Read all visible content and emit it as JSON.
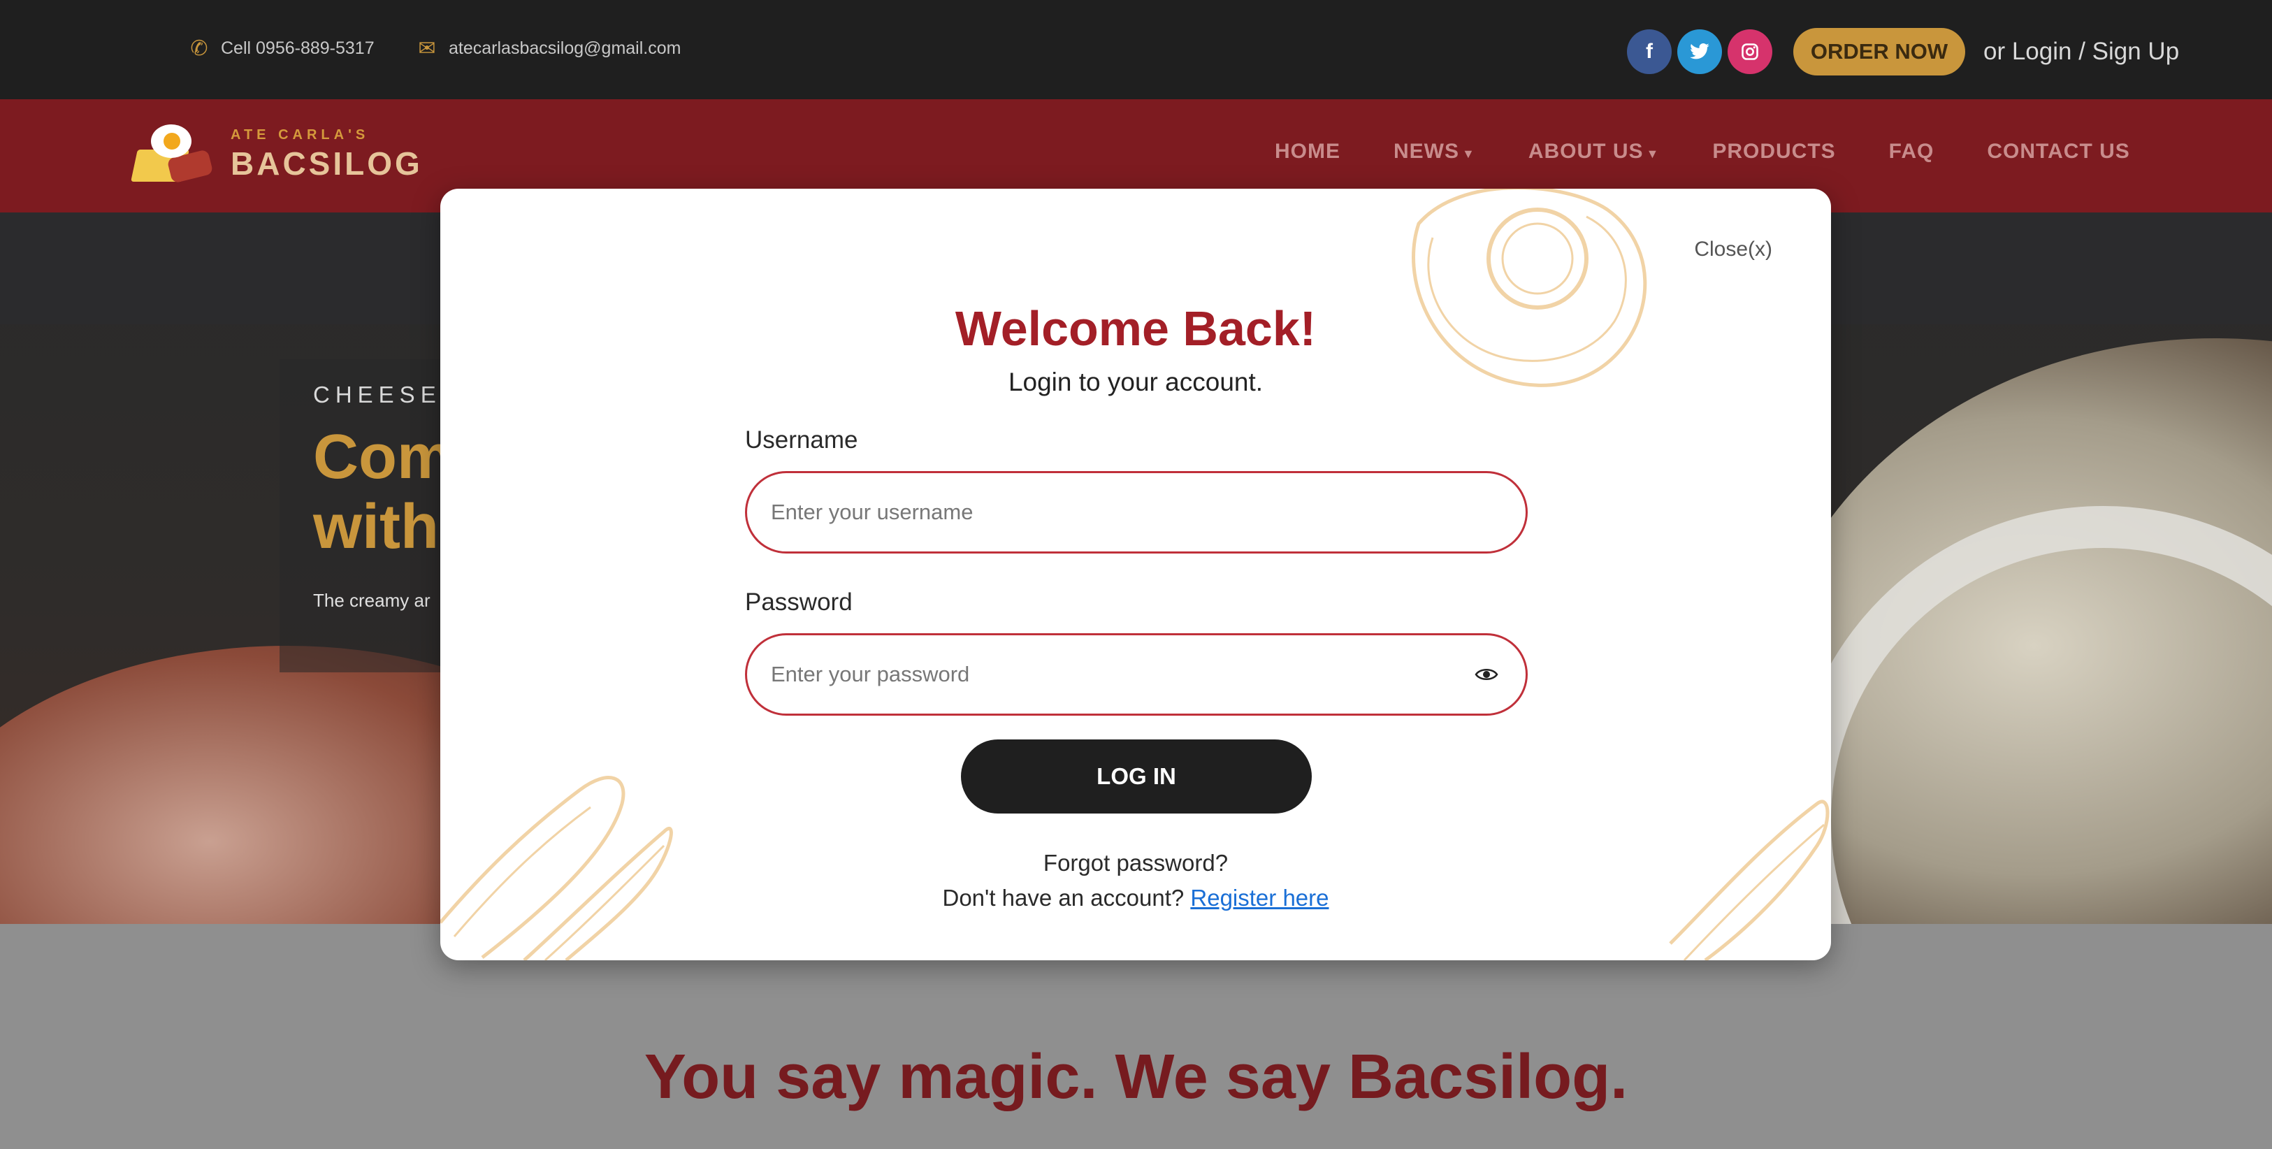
{
  "topbar": {
    "phone_icon": "phone-icon",
    "phone_text": "Cell 0956-889-5317",
    "email_icon": "envelope-icon",
    "email_text": "atecarlasbacsilog@gmail.com",
    "socials": [
      "facebook-icon",
      "twitter-icon",
      "instagram-icon"
    ],
    "order_label": "ORDER NOW",
    "login_label": "or Login / Sign Up"
  },
  "navbar": {
    "logo_small": "ATE CARLA'S",
    "logo_big": "BACSILOG",
    "items": [
      {
        "label": "HOME",
        "has_dropdown": false
      },
      {
        "label": "NEWS",
        "has_dropdown": true
      },
      {
        "label": "ABOUT US",
        "has_dropdown": true
      },
      {
        "label": "PRODUCTS",
        "has_dropdown": false
      },
      {
        "label": "FAQ",
        "has_dropdown": false
      },
      {
        "label": "CONTACT US",
        "has_dropdown": false
      }
    ]
  },
  "hero": {
    "kicker": "CHEESEY",
    "title_line1": "Com",
    "title_line2": "with",
    "description": "The creamy ar"
  },
  "section": {
    "tagline": "You say magic. We say Bacsilog."
  },
  "modal": {
    "close_label": "Close(x)",
    "title": "Welcome Back!",
    "subtitle": "Login to your account.",
    "username_label": "Username",
    "username_placeholder": "Enter your username",
    "username_value": "",
    "password_label": "Password",
    "password_placeholder": "Enter your password",
    "password_value": "",
    "login_button": "LOG IN",
    "forgot_label": "Forgot password?",
    "register_prompt": "Don't have an account?",
    "register_link": "Register here"
  },
  "colors": {
    "brand_red": "#7d1b20",
    "accent_gold": "#c9963c",
    "title_red": "#a31f27",
    "link_blue": "#1a6fd6"
  }
}
